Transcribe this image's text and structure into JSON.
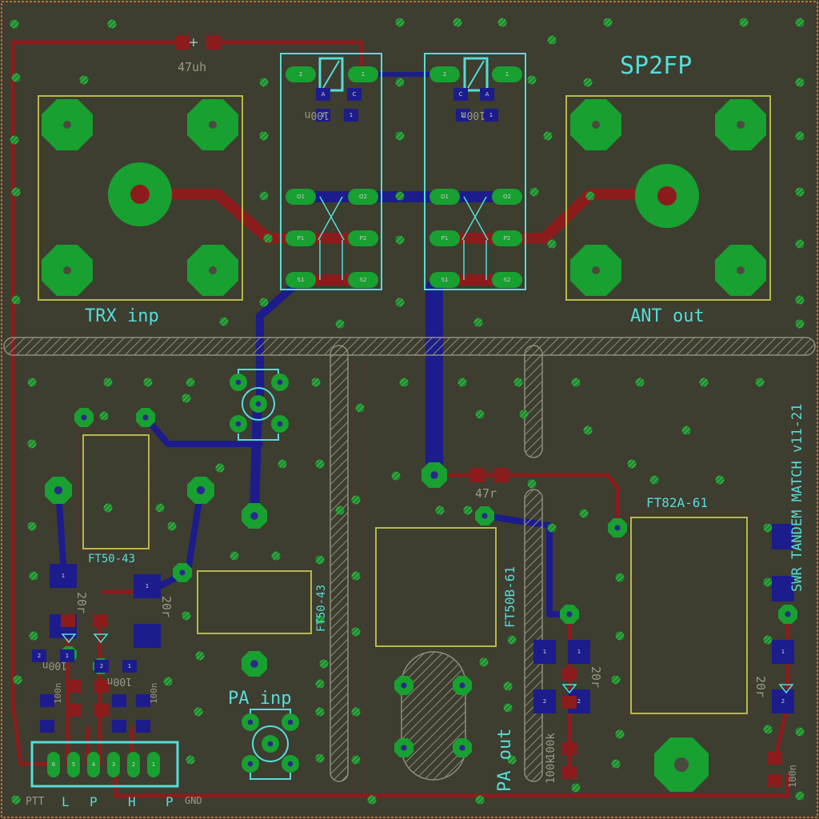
{
  "title": "SP2FP",
  "subtitle": "SWR TANDEM MATCH v11-21",
  "colors": {
    "board": "#3d3d30",
    "top_copper": "#8c1c1c",
    "bottom_copper": "#1c1c8c",
    "via": "#18a030",
    "outline_cyan": "#55ddd8",
    "outline_yellow": "#b8b84a",
    "hatch": "#9a9a86",
    "edge": "#c46a30"
  },
  "labels": {
    "trx_inp": "TRX inp",
    "ant_out": "ANT out",
    "pa_inp": "PA inp",
    "pa_out": "PA out",
    "l47uh": "47uh",
    "r47": "47r",
    "ft50_43a": "FT50-43",
    "ft50_43b": "FT50-43",
    "ft50b_61": "FT50B-61",
    "ft82a_61": "FT82A-61",
    "c100n_relay1": "100n",
    "c100n_relay2": "100n",
    "c100n_left1": "100n",
    "c100n_left2": "100n",
    "c100n_left3": "100n",
    "c100n_left4": "100n",
    "c100n_right": "100n",
    "r100k_a": "100k",
    "r100k_b": "100k",
    "r20_a": "20r",
    "r20_b": "20r",
    "r20_c": "20r",
    "pin_1": "1",
    "pin_2": "2",
    "pin_3": "3",
    "pin_4": "4",
    "pin_5": "5",
    "pin_6": "6",
    "pin_a": "A",
    "pin_c": "C",
    "pin_o1": "O1",
    "pin_o2": "O2",
    "pin_p1": "P1",
    "pin_p2": "P2",
    "pin_s1": "S1",
    "pin_s2": "S2",
    "pin_n": "+",
    "conn_ptt": "PTT",
    "conn_l": "L",
    "conn_p1": "P",
    "conn_h": "H",
    "conn_p2": "P",
    "conn_gnd": "GND"
  }
}
